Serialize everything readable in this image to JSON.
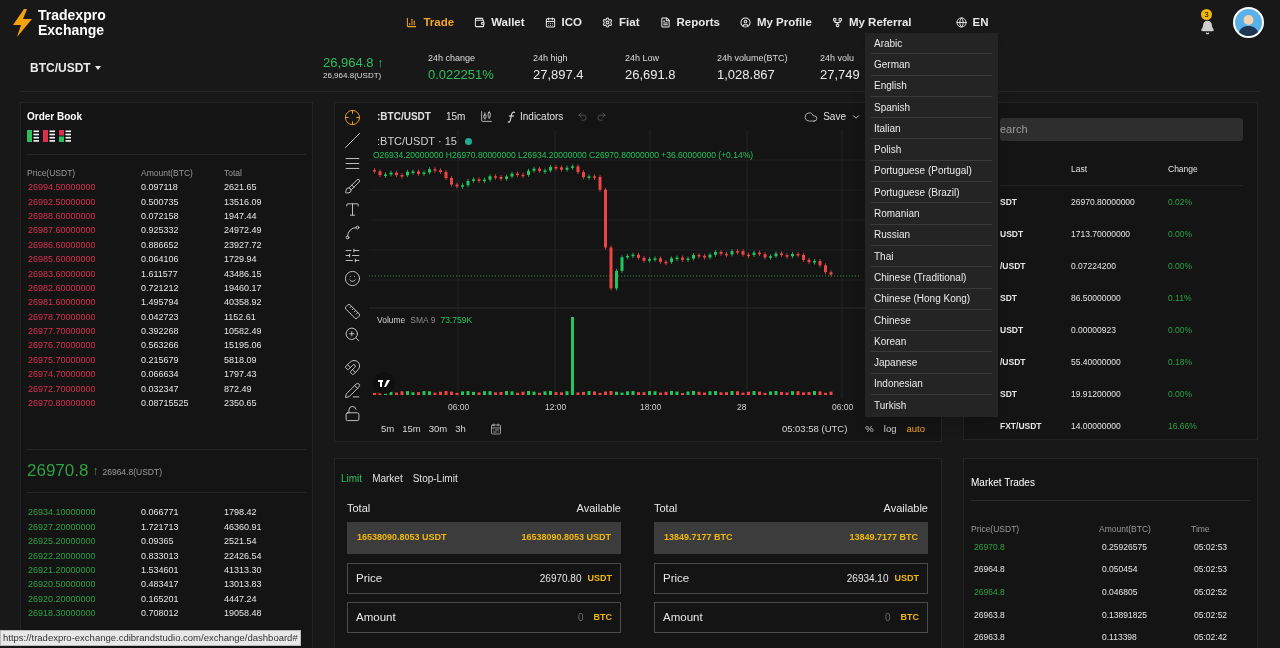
{
  "logo": {
    "line1": "Tradexpro",
    "line2": "Exchange"
  },
  "nav": [
    {
      "label": "Trade",
      "selected": true
    },
    {
      "label": "Wallet",
      "selected": false
    },
    {
      "label": "ICO",
      "selected": false
    },
    {
      "label": "Fiat",
      "selected": false
    },
    {
      "label": "Reports",
      "selected": false
    },
    {
      "label": "My Profile",
      "selected": false
    },
    {
      "label": "My Referral",
      "selected": false
    }
  ],
  "language": {
    "label": "EN",
    "options": [
      "Arabic",
      "German",
      "English",
      "Spanish",
      "Italian",
      "Polish",
      "Portuguese (Portugal)",
      "Portuguese (Brazil)",
      "Romanian",
      "Russian",
      "Thai",
      "Chinese (Traditional)",
      "Chinese (Hong Kong)",
      "Chinese",
      "Korean",
      "Japanese",
      "Indonesian",
      "Turkish"
    ]
  },
  "notifications": {
    "count": "3"
  },
  "ticker": {
    "pair": "BTC/USDT",
    "price": "26,964.8 ↑",
    "price_usdt": "26,964.8(USDT)",
    "stats": [
      {
        "label": "24h change",
        "value": "0.022251%",
        "kind": "change"
      },
      {
        "label": "24h high",
        "value": "27,897.4",
        "kind": "plain"
      },
      {
        "label": "24h Low",
        "value": "26,691.8",
        "kind": "plain"
      },
      {
        "label": "24h volume(BTC)",
        "value": "1,028.867",
        "kind": "plain"
      },
      {
        "label": "24h volu",
        "value": "27,749",
        "kind": "plain"
      }
    ]
  },
  "order_book": {
    "title": "Order Book",
    "columns": [
      "Price(USDT)",
      "Amount(BTC)",
      "Total"
    ],
    "asks": [
      {
        "price": "26994.50000000",
        "amount": "0.097118",
        "total": "2621.65"
      },
      {
        "price": "26992.50000000",
        "amount": "0.500735",
        "total": "13516.09"
      },
      {
        "price": "26988.60000000",
        "amount": "0.072158",
        "total": "1947.44"
      },
      {
        "price": "26987.60000000",
        "amount": "0.925332",
        "total": "24972.49"
      },
      {
        "price": "26986.60000000",
        "amount": "0.886652",
        "total": "23927.72"
      },
      {
        "price": "26985.60000000",
        "amount": "0.064106",
        "total": "1729.94"
      },
      {
        "price": "26983.60000000",
        "amount": "1.611577",
        "total": "43486.15"
      },
      {
        "price": "26982.60000000",
        "amount": "0.721212",
        "total": "19460.17"
      },
      {
        "price": "26981.60000000",
        "amount": "1.495794",
        "total": "40358.92"
      },
      {
        "price": "26978.70000000",
        "amount": "0.042723",
        "total": "1152.61"
      },
      {
        "price": "26977.70000000",
        "amount": "0.392268",
        "total": "10582.49"
      },
      {
        "price": "26976.70000000",
        "amount": "0.563266",
        "total": "15195.06"
      },
      {
        "price": "26975.70000000",
        "amount": "0.215679",
        "total": "5818.09"
      },
      {
        "price": "26974.70000000",
        "amount": "0.066634",
        "total": "1797.43"
      },
      {
        "price": "26972.70000000",
        "amount": "0.032347",
        "total": "872.49"
      },
      {
        "price": "26970.80000000",
        "amount": "0.08715525",
        "total": "2350.65"
      }
    ],
    "last_price": "26970.8",
    "last_arrow": "↑",
    "last_price_usdt": "26964.8(USDT)",
    "bids": [
      {
        "price": "26934.10000000",
        "amount": "0.066771",
        "total": "1798.42"
      },
      {
        "price": "26927.20000000",
        "amount": "1.721713",
        "total": "46360.91"
      },
      {
        "price": "26925.20000000",
        "amount": "0.09365",
        "total": "2521.54"
      },
      {
        "price": "26922.20000000",
        "amount": "0.833013",
        "total": "22426.54"
      },
      {
        "price": "26921.20000000",
        "amount": "1.534601",
        "total": "41313.30"
      },
      {
        "price": "26920.50000000",
        "amount": "0.483417",
        "total": "13013.83"
      },
      {
        "price": "26920.20000000",
        "amount": "0.165201",
        "total": "4447.24"
      },
      {
        "price": "26918.30000000",
        "amount": "0.708012",
        "total": "19058.48"
      }
    ]
  },
  "chart": {
    "symbol": ":BTC/USDT",
    "interval": "15m",
    "indicators": "Indicators",
    "save": "Save",
    "legend": ":BTC/USDT · 15",
    "ohlc": "O26934.20000000 H26970.80000000 L26934.20000000 C26970.80000000 +36.60000000 (+0.14%)",
    "volume_label": "Volume",
    "volume_sma": "SMA 9",
    "volume_value": "73.759K",
    "time_labels": [
      "06:00",
      "12:00",
      "18:00",
      "28",
      "06:00"
    ],
    "ranges": [
      "5m",
      "15m",
      "30m",
      "3h"
    ],
    "clock": "05:03:58 (UTC)",
    "scale_options": [
      {
        "label": "%",
        "selected": false
      },
      {
        "label": "log",
        "selected": false
      },
      {
        "label": "auto",
        "selected": true
      }
    ]
  },
  "markets": {
    "search_placeholder": "earch",
    "columns": [
      "Last",
      "Change"
    ],
    "rows": [
      {
        "pair": "SDT",
        "last": "26970.80000000",
        "change": "0.02%"
      },
      {
        "pair": "USDT",
        "last": "1713.70000000",
        "change": "0.00%"
      },
      {
        "pair": "/USDT",
        "last": "0.07224200",
        "change": "0.00%"
      },
      {
        "pair": "SDT",
        "last": "86.50000000",
        "change": "0.11%"
      },
      {
        "pair": "USDT",
        "last": "0.00000923",
        "change": "0.00%"
      },
      {
        "pair": "/USDT",
        "last": "55.40000000",
        "change": "0.18%"
      },
      {
        "pair": "SDT",
        "last": "19.91200000",
        "change": "0.00%"
      },
      {
        "pair": "FXT/USDT",
        "last": "14.00000000",
        "change": "16.66%"
      }
    ]
  },
  "trade_form": {
    "tabs": [
      {
        "label": "Limit",
        "selected": true
      },
      {
        "label": "Market",
        "selected": false
      },
      {
        "label": "Stop-Limit",
        "selected": false
      }
    ],
    "sides": [
      {
        "total_label": "Total",
        "available_label": "Available",
        "total": "16538090.8053 USDT",
        "available": "16538090.8053 USDT",
        "price_label": "Price",
        "price": "26970.80",
        "price_unit": "USDT",
        "amount_label": "Amount",
        "amount_placeholder": "0",
        "amount_unit": "BTC"
      },
      {
        "total_label": "Total",
        "available_label": "Available",
        "total": "13849.7177 BTC",
        "available": "13849.7177 BTC",
        "price_label": "Price",
        "price": "26934.10",
        "price_unit": "USDT",
        "amount_label": "Amount",
        "amount_placeholder": "0",
        "amount_unit": "BTC"
      }
    ]
  },
  "market_trades": {
    "title": "Market Trades",
    "columns": [
      "Price(USDT)",
      "Amount(BTC)",
      "Time"
    ],
    "rows": [
      {
        "price": "26970.8",
        "amount": "0.25926575",
        "time": "05:02:53",
        "kind": "up"
      },
      {
        "price": "26964.8",
        "amount": "0.050454",
        "time": "05:02:53",
        "kind": "flat"
      },
      {
        "price": "26964.8",
        "amount": "0.046805",
        "time": "05:02:52",
        "kind": "up"
      },
      {
        "price": "26963.8",
        "amount": "0.13891825",
        "time": "05:02:52",
        "kind": "flat"
      },
      {
        "price": "26963.8",
        "amount": "0.113398",
        "time": "05:02:42",
        "kind": "flat"
      }
    ]
  },
  "status_url": "https://tradexpro-exchange.cdibrandstudio.com/exchange/dashboard#"
}
